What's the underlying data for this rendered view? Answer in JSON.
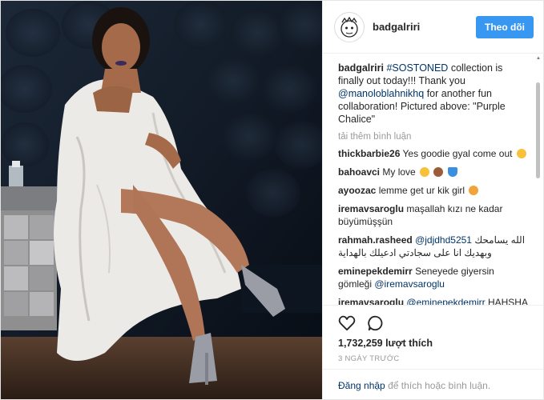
{
  "post": {
    "username": "badgalriri",
    "follow_label": "Theo dõi",
    "caption": {
      "user": "badgalriri",
      "hashtag": "#SOSTONED",
      "text1": "collection is finally out today!!! Thank you",
      "mention": "@manoloblahnikhq",
      "text2": "for another fun collaboration! Pictured above: \"Purple Chalice\""
    },
    "load_more": "tải thêm bình luận",
    "comments": [
      {
        "user": "thickbarbie26",
        "text": "Yes goodie gyal come out",
        "mention": "",
        "rest": ""
      },
      {
        "user": "bahoavci",
        "text": "My love",
        "mention": "",
        "rest": ""
      },
      {
        "user": "ayoozac",
        "text": "lemme get ur kik girl",
        "mention": "",
        "rest": ""
      },
      {
        "user": "iremavsaroglu",
        "text": "maşallah kızı ne kadar büyümüşşün",
        "mention": "",
        "rest": ""
      },
      {
        "user": "rahmah.rasheed",
        "text": "",
        "mention": "@jdjdhd5251",
        "rest": "الله يسامحك وبهديك انا على سجادتي ادعيلك بالهداية"
      },
      {
        "user": "eminepekdemirr",
        "text": "Seneyede giyersin gömleği",
        "mention": "@iremavsaroglu",
        "rest": ""
      },
      {
        "user": "iremavsaroglu",
        "text": "",
        "mention": "@eminepekdemirr",
        "rest": "HAHSHAHAHAHHAHAHAHAHAHA"
      }
    ],
    "likes": "1,732,259 lượt thích",
    "date": "3 NGÀY TRƯỚC",
    "login_link": "Đăng nhập",
    "login_rest": "để thích hoặc bình luận."
  },
  "icons": {
    "heart": "heart-icon",
    "comment": "comment-icon"
  },
  "colors": {
    "accent": "#3897f0",
    "link": "#003569",
    "muted": "#999999"
  }
}
